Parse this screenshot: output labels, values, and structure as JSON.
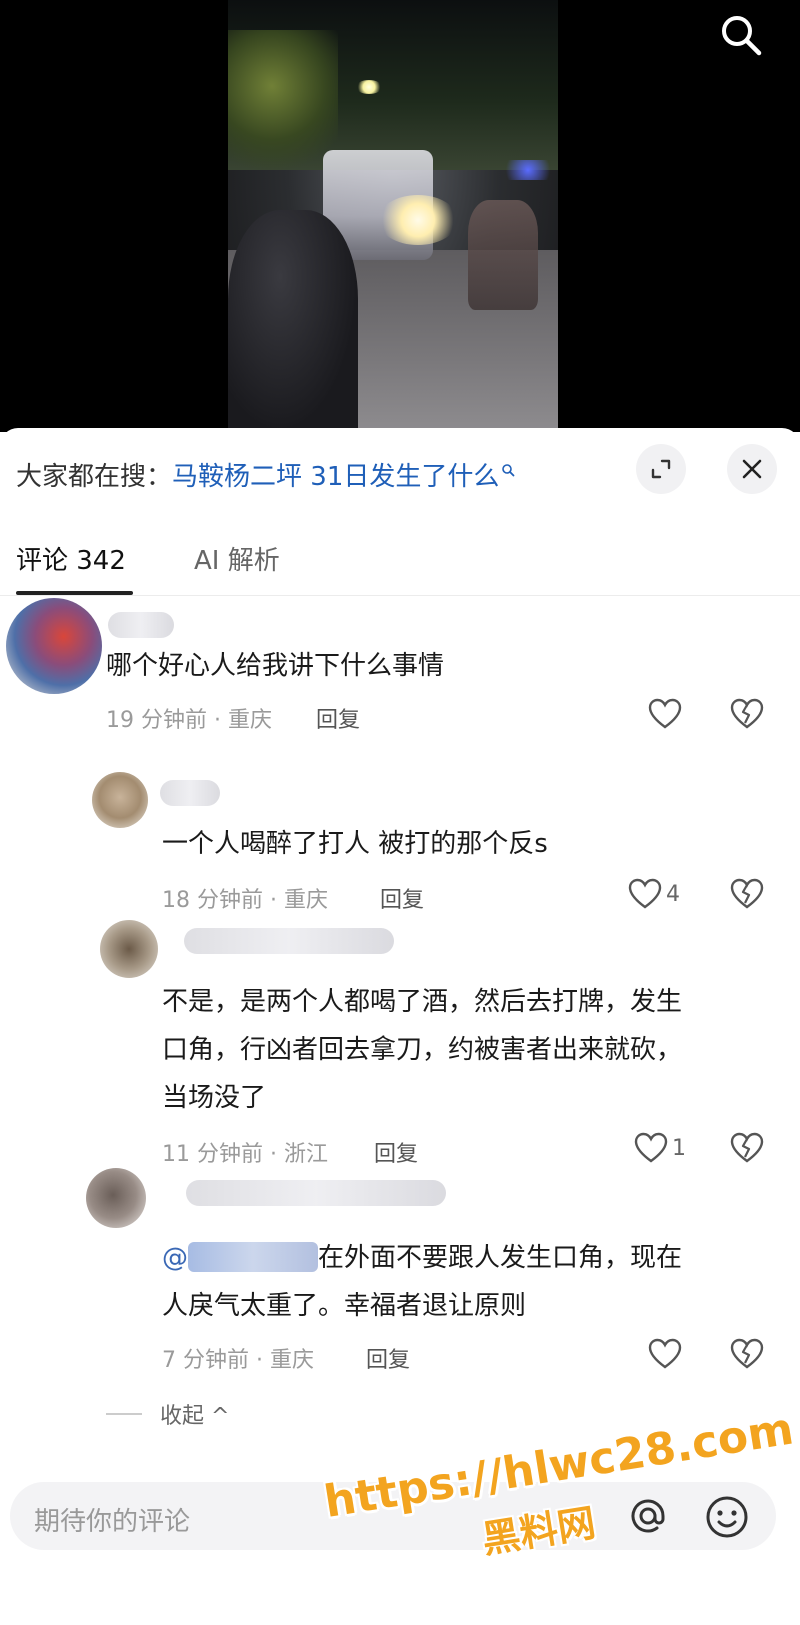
{
  "video": {
    "search_icon": "search-icon"
  },
  "search_bar": {
    "prefix": "大家都在搜：",
    "query": "马鞍杨二坪 31日发生了什么"
  },
  "tabs": {
    "comments_label": "评论 342",
    "ai_label": "AI 解析"
  },
  "comments": [
    {
      "text": "哪个好心人给我讲下什么事情",
      "time": "19 分钟前 · 重庆",
      "reply": "回复",
      "likes": ""
    },
    {
      "text": "一个人喝醉了打人 被打的那个反s",
      "time": "18 分钟前 · 重庆",
      "reply": "回复",
      "likes": "4"
    },
    {
      "lines": [
        "不是，是两个人都喝了酒，然后去打牌，发生",
        "口角，行凶者回去拿刀，约被害者出来就砍，",
        "当场没了"
      ],
      "time": "11 分钟前 · 浙江",
      "reply": "回复",
      "likes": "1"
    },
    {
      "mention": "@",
      "lines": [
        "在外面不要跟人发生口角，现在",
        "人戾气太重了。幸福者退让原则"
      ],
      "time": "7 分钟前 · 重庆",
      "reply": "回复",
      "likes": ""
    }
  ],
  "collapse_label": "收起 ^",
  "input": {
    "placeholder": "期待你的评论"
  },
  "watermark": {
    "url": "https://hlwc28.com",
    "name": "黑料网"
  },
  "colors": {
    "link_blue": "#1f5fb8",
    "watermark_orange": "#f3a41f"
  }
}
